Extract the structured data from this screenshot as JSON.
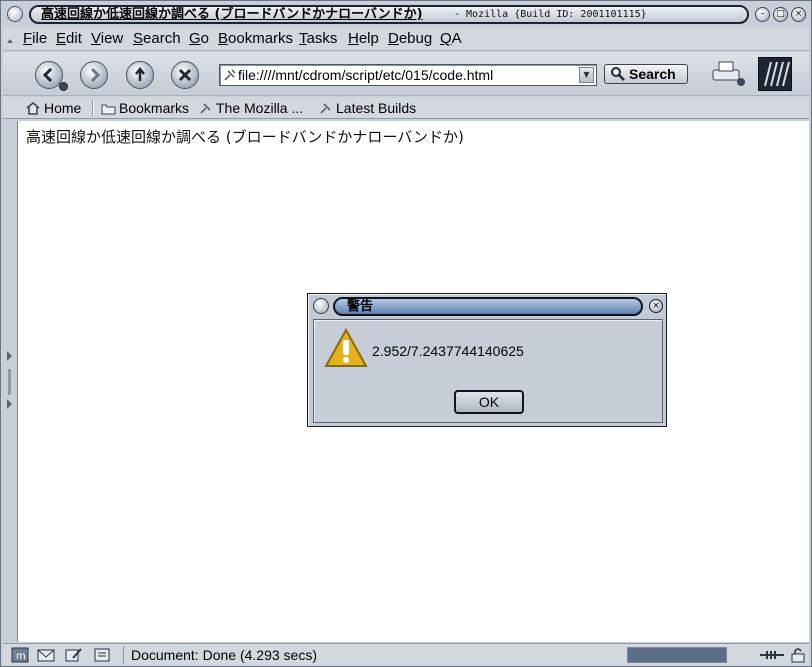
{
  "window": {
    "title": "高速回線か低速回線か調べる (ブロードバンドかナローバンドか)",
    "subtitle": "- Mozilla {Build ID: 2001101115}"
  },
  "menu": [
    "File",
    "Edit",
    "View",
    "Search",
    "Go",
    "Bookmarks",
    "Tasks",
    "Help",
    "Debug",
    "QA"
  ],
  "navigation": {
    "url": "file:////mnt/cdrom/script/etc/015/code.html",
    "search_label": "Search"
  },
  "personal_toolbar": {
    "home": "Home",
    "bookmarks": "Bookmarks",
    "link1": "The Mozilla ...",
    "link2": "Latest Builds"
  },
  "page": {
    "heading": "高速回線か低速回線か調べる (ブロードバンドかナローバンドか)"
  },
  "dialog": {
    "title": "警告",
    "message": "2.952/7.2437744140625",
    "ok_label": "OK"
  },
  "status": {
    "text": "Document: Done (4.293 secs)",
    "progress": 1
  },
  "colors": {
    "chrome": "#c9cfd8",
    "dialog_title": "#5d7fb0",
    "warning": "#e3b21c"
  }
}
